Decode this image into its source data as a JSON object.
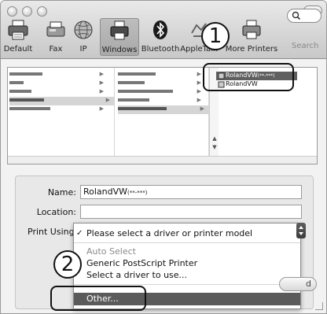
{
  "toolbar": {
    "items": [
      {
        "label": "Default",
        "icon": "printer-default-icon"
      },
      {
        "label": "Fax",
        "icon": "fax-icon"
      },
      {
        "label": "IP",
        "icon": "globe-icon"
      },
      {
        "label": "Windows",
        "icon": "windows-printer-icon",
        "selected": true
      },
      {
        "label": "Bluetooth",
        "icon": "bluetooth-icon"
      },
      {
        "label": "AppleTalk",
        "icon": "appletalk-icon"
      },
      {
        "label": "More Printers",
        "icon": "printer-more-icon"
      }
    ],
    "search_label": "Search"
  },
  "browser": {
    "models": [
      {
        "label": "RolandVW",
        "suffix": "(**-***)",
        "selected": true
      },
      {
        "label": "RolandVW",
        "selected": false
      }
    ]
  },
  "form": {
    "name_label": "Name:",
    "name_value": "RolandVW",
    "name_suffix": "(**-***)",
    "location_label": "Location:",
    "location_value": "",
    "print_using_label": "Print Using"
  },
  "menu": {
    "items": [
      {
        "label": "Please select a driver or printer model",
        "checked": true,
        "disabled": false
      },
      {
        "label": "Auto Select",
        "disabled": true
      },
      {
        "label": "Generic PostScript Printer",
        "disabled": false
      },
      {
        "label": "Select a driver to use...",
        "disabled": false
      },
      {
        "label": "Other...",
        "highlighted": true
      }
    ],
    "checkmark": "✓"
  },
  "buttons": {
    "add_partial": "d"
  },
  "callouts": {
    "one": "1",
    "two": "2"
  }
}
